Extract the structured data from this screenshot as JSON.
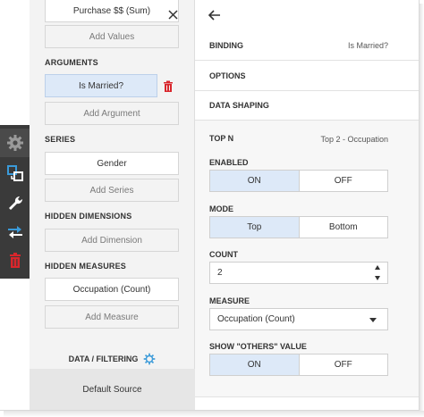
{
  "left_panel": {
    "values_field": "Purchase $$ (Sum)",
    "add_values": "Add Values",
    "arguments_label": "ARGUMENTS",
    "argument_field": "Is Married?",
    "add_argument": "Add Argument",
    "series_label": "SERIES",
    "series_field": "Gender",
    "add_series": "Add Series",
    "hidden_dimensions_label": "HIDDEN DIMENSIONS",
    "add_dimension": "Add Dimension",
    "hidden_measures_label": "HIDDEN MEASURES",
    "measure_field": "Occupation (Count)",
    "add_measure": "Add Measure",
    "data_filtering_label": "DATA / FILTERING",
    "default_source": "Default Source"
  },
  "right_panel": {
    "binding_title": "BINDING",
    "binding_value": "Is Married?",
    "options_title": "OPTIONS",
    "data_shaping_title": "DATA SHAPING",
    "top_n_title": "TOP N",
    "top_n_value": "Top 2 - Occupation",
    "enabled_label": "ENABLED",
    "enabled_on": "ON",
    "enabled_off": "OFF",
    "mode_label": "MODE",
    "mode_top": "Top",
    "mode_bottom": "Bottom",
    "count_label": "COUNT",
    "count_value": "2",
    "measure_label": "MEASURE",
    "measure_value": "Occupation (Count)",
    "show_others_label": "SHOW \"OTHERS\" VALUE",
    "others_on": "ON",
    "others_off": "OFF"
  },
  "colors": {
    "toolbar_bg": "#3a3a3a",
    "selected_bg": "#dde9f8",
    "accent_blue": "#3a9ad9",
    "delete_red": "#d9262c"
  },
  "icons": {
    "toolbar": [
      "gear-icon",
      "binding-icon",
      "wrench-icon",
      "convert-icon",
      "trash-icon"
    ],
    "close": "close-icon",
    "back": "back-arrow-icon",
    "filter": "gear-icon"
  }
}
